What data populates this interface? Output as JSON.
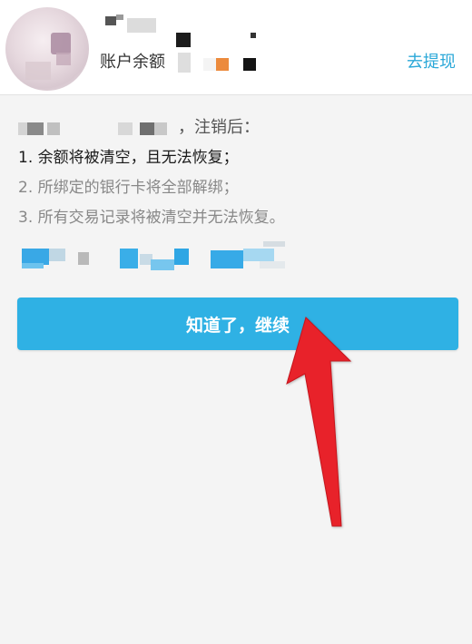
{
  "account": {
    "balance_label": "账户余额",
    "withdraw_label": "去提现"
  },
  "notice": {
    "intro_suffix": "，注销后：",
    "items": [
      "1. 余额将被清空，且无法恢复；",
      "2. 所绑定的银行卡将全部解绑；",
      "3. 所有交易记录将被清空并无法恢复。"
    ]
  },
  "actions": {
    "continue_label": "知道了，继续"
  },
  "colors": {
    "accent": "#2fb1e4",
    "link": "#2ba8d8",
    "arrow": "#e8202a"
  },
  "annotations": {
    "arrow_icon": "red-arrow-icon"
  }
}
